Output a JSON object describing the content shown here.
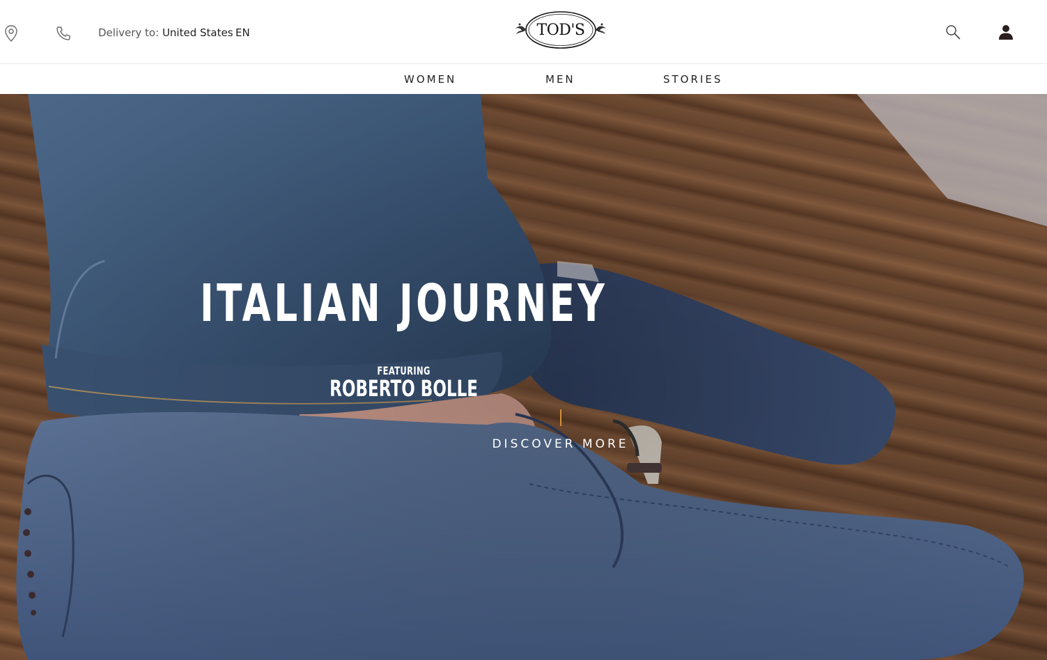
{
  "header": {
    "delivery_label": "Delivery to:",
    "delivery_country": "United States",
    "language": "EN",
    "logo_text": "TOD'S",
    "icons": {
      "location": "location-pin-icon",
      "phone": "phone-icon",
      "search": "search-icon",
      "account": "account-icon"
    }
  },
  "nav": {
    "items": [
      {
        "label": "WOMEN"
      },
      {
        "label": "MEN"
      },
      {
        "label": "STORIES"
      }
    ]
  },
  "hero": {
    "title": "ITALIAN JOURNEY",
    "featuring_label": "FEATURING",
    "featured_name": "ROBERTO BOLLE",
    "cta_label": "DISCOVER MORE",
    "accent_color": "#d4913a"
  }
}
